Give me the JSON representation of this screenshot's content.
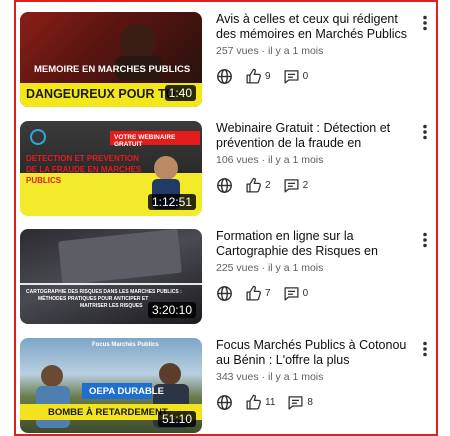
{
  "videos": [
    {
      "title": "Avis à celles et ceux qui rédigent des mémoires en Marchés Publics",
      "stats": "257 vues · il y a 1 mois",
      "duration": "1:40",
      "likes": "9",
      "comments": "0",
      "thumb_text": [
        "MEMOIRE EN MARCHES PUBLICS",
        "DANGEUREUX POUR TO"
      ]
    },
    {
      "title": "Webinaire Gratuit : Détection et prévention de la fraude en Marchés P...",
      "stats": "106 vues · il y a 1 mois",
      "duration": "1:12:51",
      "likes": "2",
      "comments": "2",
      "thumb_text": [
        "VOTRE WEBINAIRE GRATUIT",
        "DETECTION ET PREVENTION",
        "DE LA FRAUDE EN MARCHES",
        "PUBLICS"
      ]
    },
    {
      "title": "Formation en ligne sur la Cartographie des Risques en Marchés Publics",
      "stats": "225 vues · il y a 1 mois",
      "duration": "3:20:10",
      "likes": "7",
      "comments": "0",
      "thumb_text": [
        "CARTOGRAPHIE DES RISQUES DANS LES MARCHES PUBLICS :",
        "MÉTHODES PRATIQUES POUR ANTICIPER ET",
        "MAITRISER LES RISQUES"
      ]
    },
    {
      "title": "Focus Marchés Publics à Cotonou au Bénin : L'offre la plus avantageuse et l...",
      "stats": "343 vues · il y a 1 mois",
      "duration": "51:10",
      "likes": "11",
      "comments": "8",
      "thumb_text": [
        "Focus Marchés Publics",
        "OEPA DURABLE",
        "BOMBE À RETARDEMENT"
      ]
    }
  ],
  "icons": {
    "visibility": "globe-icon",
    "like": "thumbs-up-icon",
    "comment": "comment-icon",
    "menu": "more-vert-icon"
  },
  "colors": {
    "frame_border": "#e02020",
    "title": "#0f0f0f",
    "meta": "#606060"
  }
}
